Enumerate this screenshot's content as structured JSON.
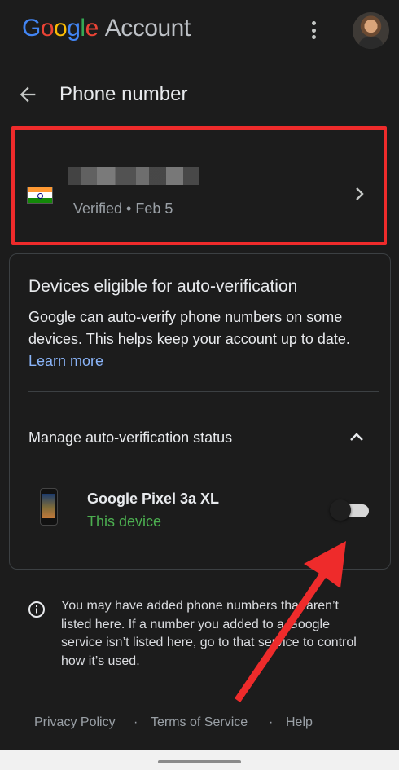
{
  "header": {
    "logo_letters": [
      "G",
      "o",
      "o",
      "g",
      "l",
      "e"
    ],
    "account_label": "Account",
    "menu_icon": "more-vert-icon",
    "avatar_icon": "user-avatar"
  },
  "title_bar": {
    "back_icon": "arrow-back-icon",
    "title": "Phone number"
  },
  "phone_card": {
    "flag_icon": "india-flag-icon",
    "status": "Verified • Feb 5",
    "chevron_icon": "chevron-right-icon",
    "highlight_color": "#ee2b2b"
  },
  "devices_card": {
    "heading": "Devices eligible for auto-verification",
    "description": "Google can auto-verify phone numbers on some devices. This helps keep your account up to date.",
    "learn_more": "Learn more",
    "manage_label": "Manage auto-verification status",
    "manage_icon": "chevron-up-icon",
    "device": {
      "name": "Google Pixel 3a XL",
      "status": "This device",
      "toggle_on": false
    }
  },
  "info": {
    "icon": "info-icon",
    "text": "You may have added phone numbers that aren’t listed here. If a number you added to a Google service isn’t listed here, go to that service to control how it’s used."
  },
  "footer": {
    "privacy": "Privacy Policy",
    "terms": "Terms of Service",
    "help": "Help",
    "separator": "·"
  },
  "colors": {
    "background": "#1c1c1c",
    "link": "#8ab4f8",
    "status_green": "#4caf50",
    "annotation_red": "#ee2b2b"
  }
}
